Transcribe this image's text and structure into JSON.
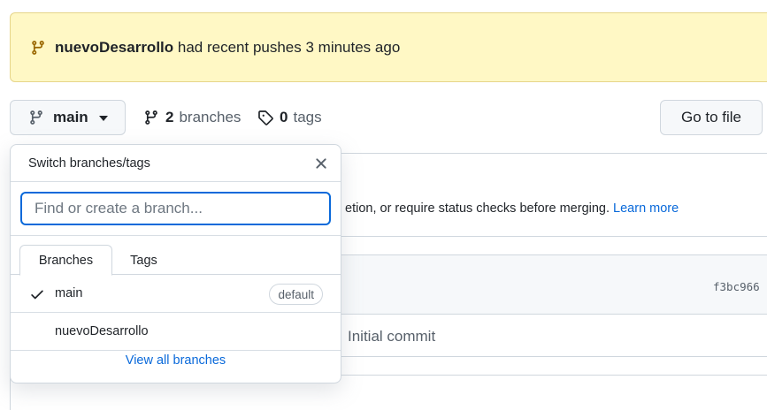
{
  "banner": {
    "branch": "nuevoDesarrollo",
    "message": " had recent pushes 3 minutes ago"
  },
  "toolbar": {
    "branch_label": "main",
    "branches_count": "2",
    "branches_label": "branches",
    "tags_count": "0",
    "tags_label": "tags",
    "goto_label": "Go to file"
  },
  "background": {
    "protect_text": "etion, or require status checks before merging.",
    "learn_more": "Learn more",
    "commit_hash": "f3bc966",
    "commit_msg": "Initial commit"
  },
  "dropdown": {
    "title": "Switch branches/tags",
    "search_placeholder": "Find or create a branch...",
    "tabs": [
      {
        "label": "Branches",
        "active": true
      },
      {
        "label": "Tags",
        "active": false
      }
    ],
    "items": [
      {
        "label": "main",
        "selected": true,
        "badge": "default"
      },
      {
        "label": "nuevoDesarrollo",
        "selected": false
      }
    ],
    "view_all": "View all branches"
  },
  "colors": {
    "accent": "#0969da",
    "banner_bg": "#fff8c5",
    "branch_icon": "#9a6700"
  }
}
